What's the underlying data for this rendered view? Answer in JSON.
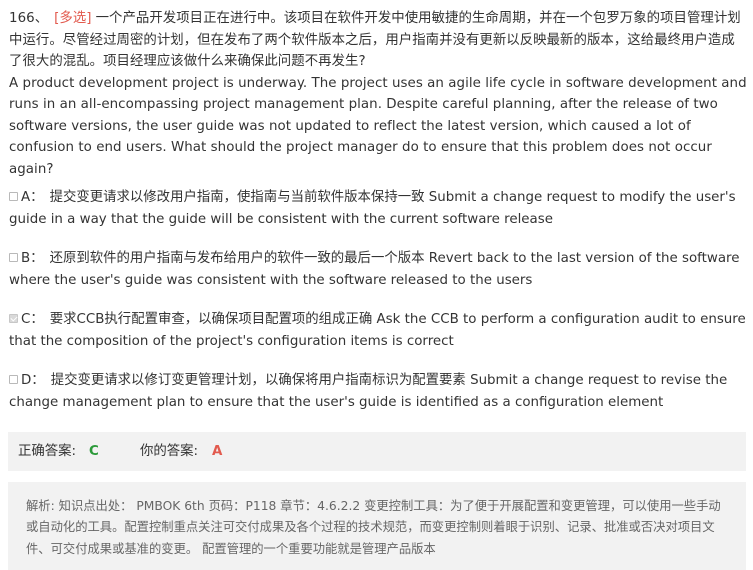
{
  "question": {
    "number": "166、",
    "tag": "[多选]",
    "text_cn": "一个产品开发项目正在进行中。该项目在软件开发中使用敏捷的生命周期，并在一个包罗万象的项目管理计划中运行。尽管经过周密的计划，但在发布了两个软件版本之后，用户指南并没有更新以反映最新的版本，这给最终用户造成了很大的混乱。项目经理应该做什么来确保此问题不再发生?",
    "text_en": "A product development project is underway. The project uses an agile life cycle in software development and runs in an all-encompassing project management plan. Despite careful planning, after the release of two software versions, the user guide was not updated to reflect the latest version, which caused a lot of confusion to end users. What should the project manager do to ensure that this problem does not occur again?"
  },
  "options": [
    {
      "letter": "A：",
      "checked": false,
      "text": "提交变更请求以修改用户指南，使指南与当前软件版本保持一致 Submit a change request to modify the user's guide in a way that the guide will be consistent with the current software release"
    },
    {
      "letter": "B：",
      "checked": false,
      "text": "还原到软件的用户指南与发布给用户的软件一致的最后一个版本 Revert back to the last version of the software where the user's guide was consistent with the software released to the users"
    },
    {
      "letter": "C：",
      "checked": true,
      "text": "要求CCB执行配置审查，以确保项目配置项的组成正确 Ask the CCB to perform a configuration audit to ensure that the composition of the project's configuration items is correct"
    },
    {
      "letter": "D：",
      "checked": false,
      "text": "提交变更请求以修订变更管理计划，以确保将用户指南标识为配置要素 Submit a change request to revise the change management plan to ensure that the user's guide is identified as a configuration element"
    }
  ],
  "answer": {
    "correct_label": "正确答案:",
    "correct_value": "C",
    "yours_label": "你的答案:",
    "yours_value": "A",
    "correct_color": "#2c9a3a",
    "yours_color": "#e25a4e"
  },
  "analysis": {
    "text": "解析: 知识点出处： PMBOK 6th 页码：P118 章节：4.6.2.2 变更控制工具：为了便于开展配置和变更管理，可以使用一些手动或自动化的工具。配置控制重点关注可交付成果及各个过程的技术规范，而变更控制则着眼于识别、记录、批准或否决对项目文件、可交付成果或基准的变更。 配置管理的一个重要功能就是管理产品版本"
  }
}
